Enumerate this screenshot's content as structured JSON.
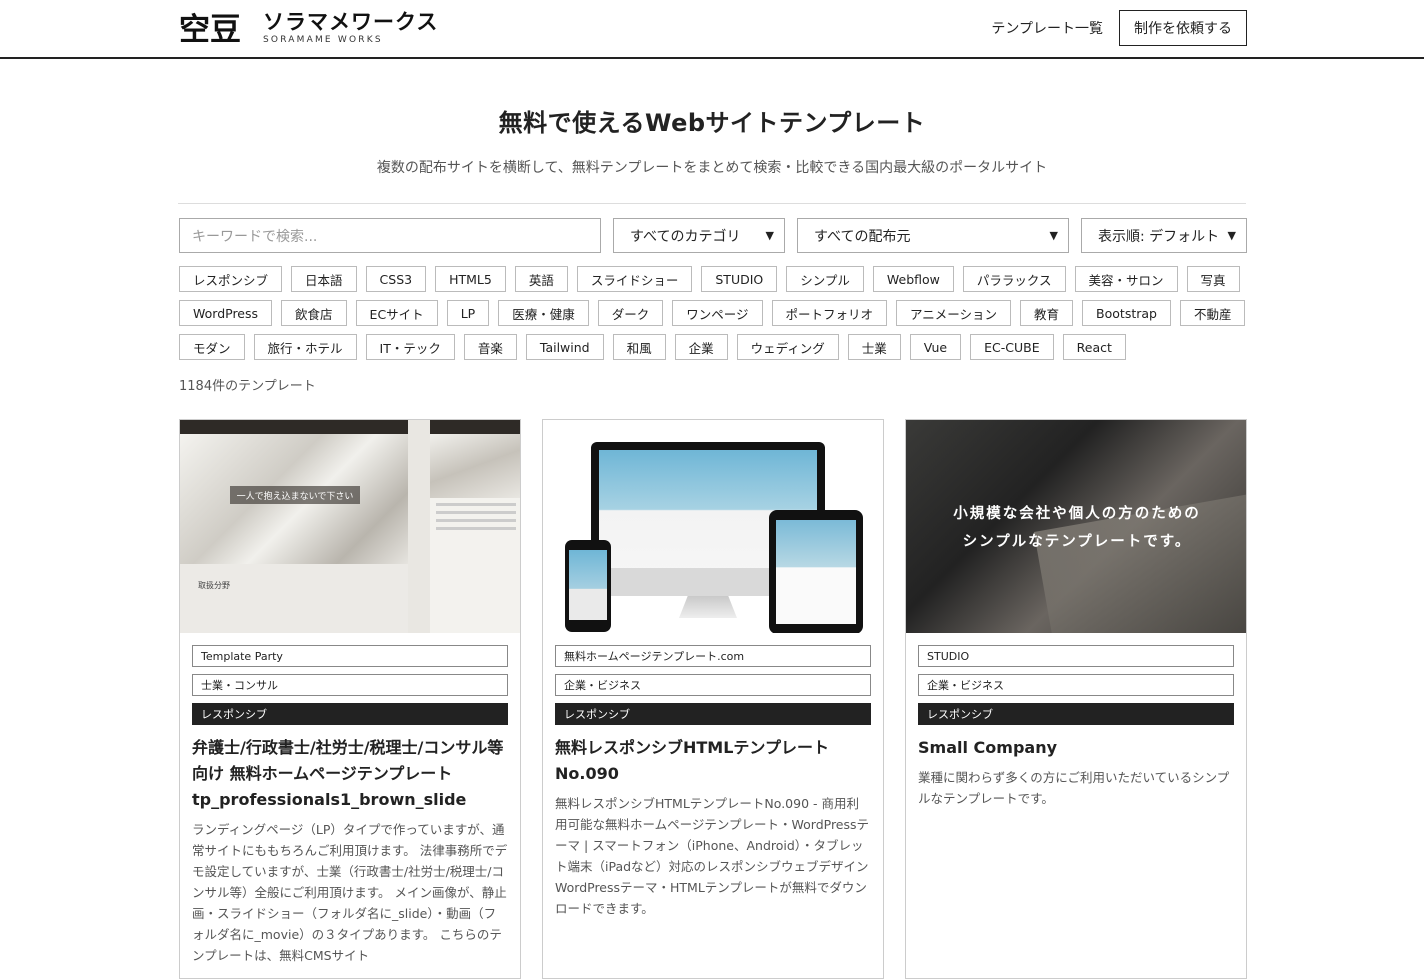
{
  "header": {
    "logo_jp": "ソラマメワークス",
    "logo_en": "SORAMAME WORKS",
    "logo_mark_text": "空豆",
    "nav_link": "テンプレート一覧",
    "nav_button": "制作を依頼する"
  },
  "hero": {
    "title": "無料で使えるWebサイトテンプレート",
    "subtitle": "複数の配布サイトを横断して、無料テンプレートをまとめて検索・比較できる国内最大級のポータルサイト"
  },
  "filters": {
    "search_placeholder": "キーワードで検索...",
    "category": "すべてのカテゴリ",
    "source": "すべての配布元",
    "sort": "表示順: デフォルト"
  },
  "tags": [
    "レスポンシブ",
    "日本語",
    "CSS3",
    "HTML5",
    "英語",
    "スライドショー",
    "STUDIO",
    "シンプル",
    "Webflow",
    "パララックス",
    "美容・サロン",
    "写真",
    "WordPress",
    "飲食店",
    "ECサイト",
    "LP",
    "医療・健康",
    "ダーク",
    "ワンページ",
    "ポートフォリオ",
    "アニメーション",
    "教育",
    "Bootstrap",
    "不動産",
    "モダン",
    "旅行・ホテル",
    "IT・テック",
    "音楽",
    "Tailwind",
    "和風",
    "企業",
    "ウェディング",
    "士業",
    "Vue",
    "EC-CUBE",
    "React"
  ],
  "count": "1184件のテンプレート",
  "cards": [
    {
      "source": "Template Party",
      "category": "士業・コンサル",
      "feature": "レスポンシブ",
      "title": "弁護士/行政書士/社労士/税理士/コンサル等向け 無料ホームページテンプレート tp_professionals1_brown_slide",
      "desc": "ランディングページ（LP）タイプで作っていますが、通常サイトにももちろんご利用頂けます。 法律事務所でデモ設定していますが、士業（行政書士/社労士/税理士/コンサル等）全般にご利用頂けます。 メイン画像が、静止画・スライドショー（フォルダ名に_slide）・動画（フォルダ名に_movie）の３タイプあります。 こちらのテンプレートは、無料CMSサイト",
      "thumb_caption": "一人で抱え込まないで下さい",
      "thumb_sub": "取扱分野"
    },
    {
      "source": "無料ホームページテンプレート.com",
      "category": "企業・ビジネス",
      "feature": "レスポンシブ",
      "title": "無料レスポンシブHTMLテンプレート No.090",
      "desc": "無料レスポンシブHTMLテンプレートNo.090 - 商用利用可能な無料ホームページテンプレート・WordPressテーマ | スマートフォン（iPhone、Android）・タブレット端末（iPadなど）対応のレスポンシブウェブデザインWordPressテーマ・HTMLテンプレートが無料でダウンロードできます。"
    },
    {
      "source": "STUDIO",
      "category": "企業・ビジネス",
      "feature": "レスポンシブ",
      "title": "Small Company",
      "desc": "業種に関わらず多くの方にご利用いただいているシンプルなテンプレートです。",
      "thumb_line1": "小規模な会社や個人の方のための",
      "thumb_line2": "シンプルなテンプレートです。"
    }
  ]
}
